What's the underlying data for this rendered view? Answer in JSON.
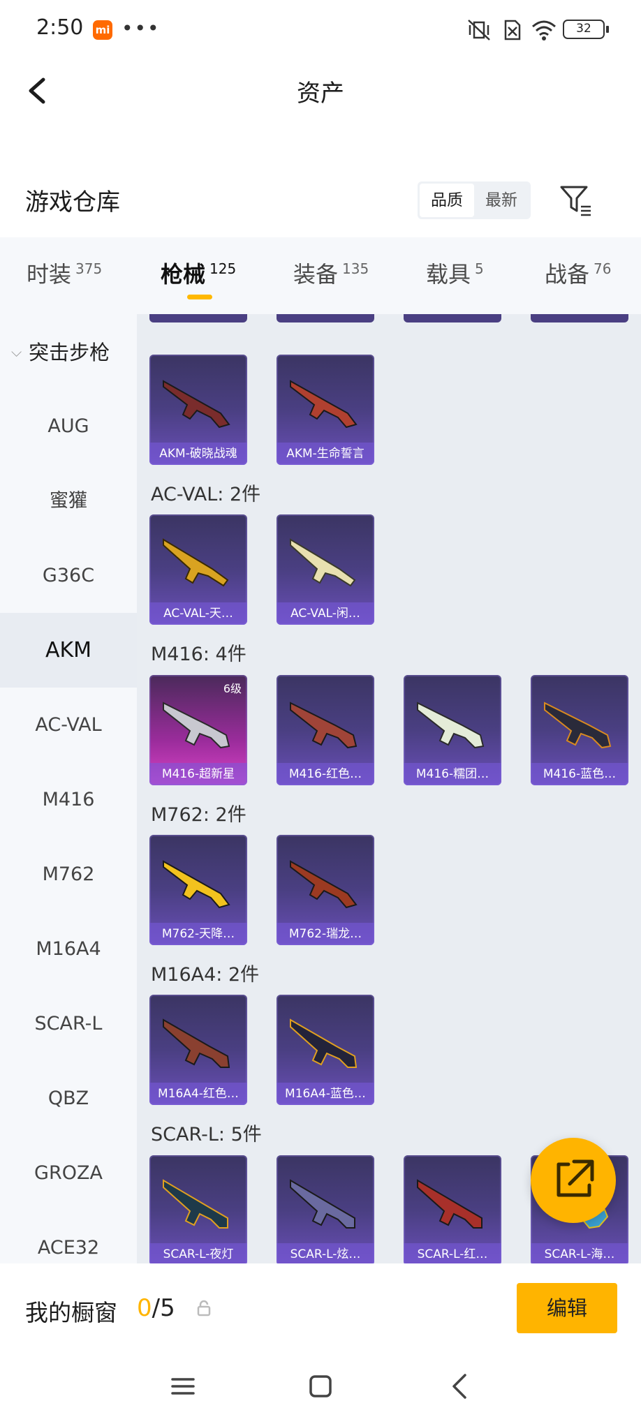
{
  "status": {
    "time": "2:50",
    "battery": "32"
  },
  "header": {
    "title": "资产"
  },
  "warehouse": {
    "title": "游戏仓库",
    "sort_options": [
      "品质",
      "最新"
    ]
  },
  "tabs": [
    {
      "label": "时装",
      "count": "375"
    },
    {
      "label": "枪械",
      "count": "125"
    },
    {
      "label": "装备",
      "count": "135"
    },
    {
      "label": "载具",
      "count": "5"
    },
    {
      "label": "战备",
      "count": "76"
    }
  ],
  "side": {
    "category": "突击步枪",
    "items": [
      "AUG",
      "蜜獾",
      "G36C",
      "AKM",
      "AC-VAL",
      "M416",
      "M762",
      "M16A4",
      "SCAR-L",
      "QBZ",
      "GROZA",
      "ACE32"
    ]
  },
  "groups": {
    "akm": {
      "items": [
        "AKM-破晓战魂",
        "AKM-生命誓言"
      ]
    },
    "acval": {
      "title": "AC-VAL: 2件",
      "items": [
        "AC-VAL-天…",
        "AC-VAL-闲…"
      ]
    },
    "m416": {
      "title": "M416: 4件",
      "items": [
        "M416-超新星",
        "M416-红色…",
        "M416-糯团…",
        "M416-蓝色…"
      ],
      "level": "6级"
    },
    "m762": {
      "title": "M762: 2件",
      "items": [
        "M762-天降…",
        "M762-瑞龙…"
      ]
    },
    "m16a4": {
      "title": "M16A4: 2件",
      "items": [
        "M16A4-红色…",
        "M16A4-蓝色…"
      ]
    },
    "scarl": {
      "title": "SCAR-L: 5件",
      "items": [
        "SCAR-L-夜灯",
        "SCAR-L-炫…",
        "SCAR-L-红…",
        "SCAR-L-海…"
      ]
    }
  },
  "showcase": {
    "title": "我的橱窗",
    "current": "0",
    "total": "/5",
    "edit_label": "编辑"
  },
  "colors": {
    "accent": "#ffb400",
    "card": "#4a3f82",
    "card_rare": "#d944c6"
  }
}
